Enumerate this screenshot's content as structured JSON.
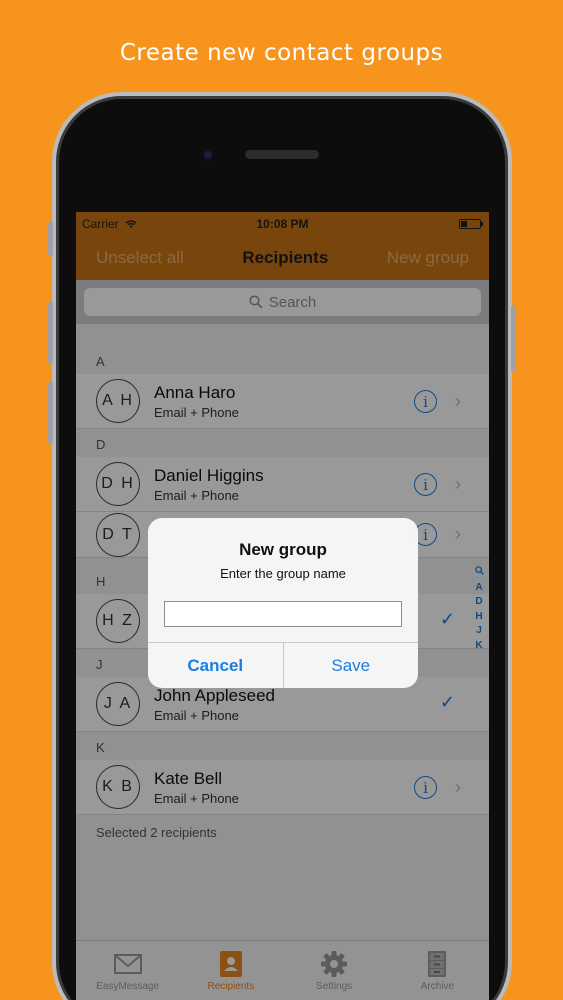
{
  "headline": "Create new contact groups",
  "statusbar": {
    "carrier": "Carrier",
    "time": "10:08 PM"
  },
  "navbar": {
    "left": "Unselect all",
    "title": "Recipients",
    "right": "New group"
  },
  "search": {
    "placeholder": "Search"
  },
  "sections": [
    {
      "letter": "A",
      "rows": [
        {
          "initials": "A H",
          "name": "Anna Haro",
          "sub": "Email + Phone",
          "state": "info"
        }
      ]
    },
    {
      "letter": "D",
      "rows": [
        {
          "initials": "D H",
          "name": "Daniel Higgins",
          "sub": "Email + Phone",
          "state": "info"
        },
        {
          "initials": "D T",
          "name": "",
          "sub": "",
          "state": "info"
        }
      ]
    },
    {
      "letter": "H",
      "rows": [
        {
          "initials": "H Z",
          "name": "",
          "sub": "",
          "state": "check"
        }
      ]
    },
    {
      "letter": "J",
      "rows": [
        {
          "initials": "J A",
          "name": "John Appleseed",
          "sub": "Email + Phone",
          "state": "check"
        }
      ]
    },
    {
      "letter": "K",
      "rows": [
        {
          "initials": "K B",
          "name": "Kate Bell",
          "sub": "Email + Phone",
          "state": "info"
        }
      ]
    }
  ],
  "footer_note": "Selected 2 recipients",
  "index_letters": [
    "A",
    "D",
    "H",
    "J",
    "K"
  ],
  "tabs": [
    {
      "label": "EasyMessage",
      "icon": "envelope-icon"
    },
    {
      "label": "Recipients",
      "icon": "contacts-book-icon",
      "active": true
    },
    {
      "label": "Settings",
      "icon": "gear-icon"
    },
    {
      "label": "Archive",
      "icon": "filing-cabinet-icon"
    }
  ],
  "alert": {
    "title": "New group",
    "message": "Enter the group name",
    "input_value": "",
    "cancel": "Cancel",
    "save": "Save"
  },
  "colors": {
    "background": "#F7941E",
    "navbar": "#C97514",
    "accent": "#1a7ee0"
  }
}
